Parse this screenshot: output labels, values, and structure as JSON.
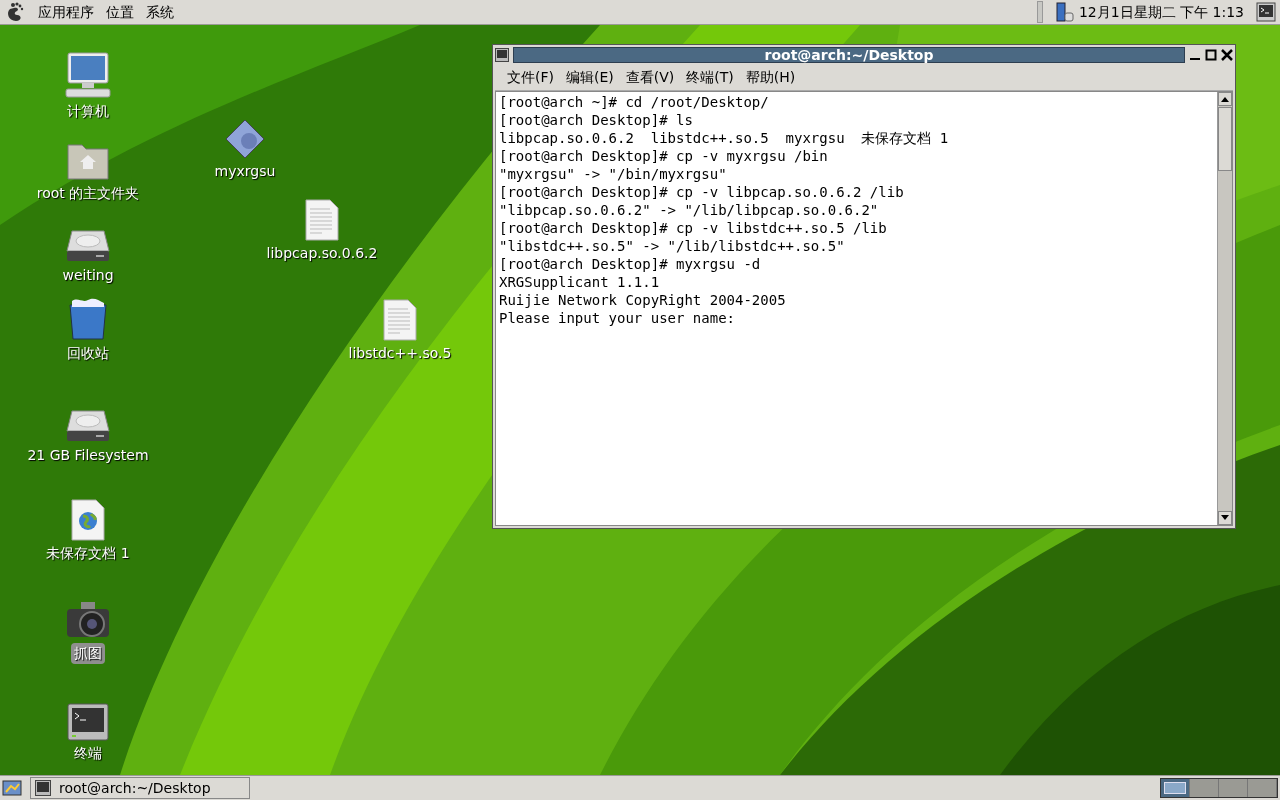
{
  "top_panel": {
    "menus": [
      "应用程序",
      "位置",
      "系统"
    ],
    "clock": "12月1日星期二 下午 1:13"
  },
  "desktop_icons": [
    {
      "label": "计算机",
      "kind": "computer",
      "selected": false
    },
    {
      "label": "root 的主文件夹",
      "kind": "folder",
      "selected": false
    },
    {
      "label": "weiting",
      "kind": "drive",
      "selected": false
    },
    {
      "label": "回收站",
      "kind": "trash",
      "selected": false
    },
    {
      "label": "21 GB Filesystem",
      "kind": "drive",
      "selected": false
    },
    {
      "label": "未保存文档 1",
      "kind": "webdoc",
      "selected": false
    },
    {
      "label": "抓图",
      "kind": "camera",
      "selected": true
    },
    {
      "label": "终端",
      "kind": "terminal",
      "selected": false
    },
    {
      "label": "myxrgsu",
      "kind": "executable",
      "selected": false
    },
    {
      "label": "libpcap.so.0.6.2",
      "kind": "document",
      "selected": false
    },
    {
      "label": "libstdc++.so.5",
      "kind": "document",
      "selected": false
    }
  ],
  "terminal_window": {
    "title": "root@arch:~/Desktop",
    "menu": [
      "文件(F)",
      "编辑(E)",
      "查看(V)",
      "终端(T)",
      "帮助(H)"
    ],
    "lines": [
      "[root@arch ~]# cd /root/Desktop/",
      "[root@arch Desktop]# ls",
      "libpcap.so.0.6.2  libstdc++.so.5  myxrgsu  未保存文档 1",
      "[root@arch Desktop]# cp -v myxrgsu /bin",
      "\"myxrgsu\" -> \"/bin/myxrgsu\"",
      "[root@arch Desktop]# cp -v libpcap.so.0.6.2 /lib",
      "\"libpcap.so.0.6.2\" -> \"/lib/libpcap.so.0.6.2\"",
      "[root@arch Desktop]# cp -v libstdc++.so.5 /lib",
      "\"libstdc++.so.5\" -> \"/lib/libstdc++.so.5\"",
      "[root@arch Desktop]# myxrgsu -d",
      "XRGSupplicant 1.1.1",
      "Ruijie Network CopyRight 2004-2005",
      "Please input your user name:"
    ]
  },
  "bottom_panel": {
    "tasks": [
      {
        "label": "root@arch:~/Desktop",
        "selected": false
      }
    ],
    "workspaces": [
      {
        "selected": true
      },
      {
        "selected": false
      },
      {
        "selected": false
      },
      {
        "selected": false
      }
    ]
  }
}
